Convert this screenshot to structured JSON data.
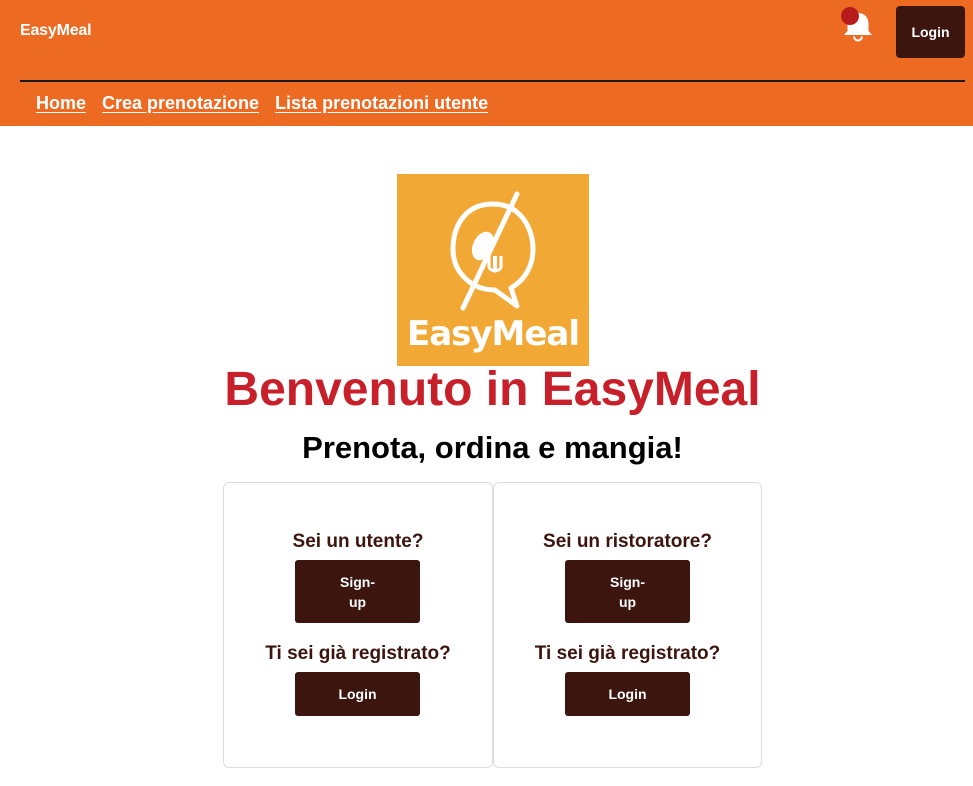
{
  "header": {
    "brand": "EasyMeal",
    "login_label": "Login",
    "colors": {
      "background": "#ec6a22",
      "button": "#3b150e",
      "badge": "#b71c1c"
    },
    "icons": {
      "notification": "bell-icon"
    }
  },
  "nav": {
    "items": [
      {
        "label": "Home"
      },
      {
        "label": "Crea prenotazione"
      },
      {
        "label": "Lista prenotazioni utente"
      }
    ]
  },
  "hero": {
    "logo_text": "EasyMeal",
    "title": "Benvenuto in EasyMeal",
    "subtitle": "Prenota, ordina e mangia!",
    "colors": {
      "title": "#c8202a",
      "logo_bg": "#f2a834"
    }
  },
  "cards": [
    {
      "question": "Sei un utente?",
      "signup_label": "Sign-up",
      "registered_question": "Ti sei già registrato?",
      "login_label": "Login"
    },
    {
      "question": "Sei un ristoratore?",
      "signup_label": "Sign-up",
      "registered_question": "Ti sei già registrato?",
      "login_label": "Login"
    }
  ]
}
